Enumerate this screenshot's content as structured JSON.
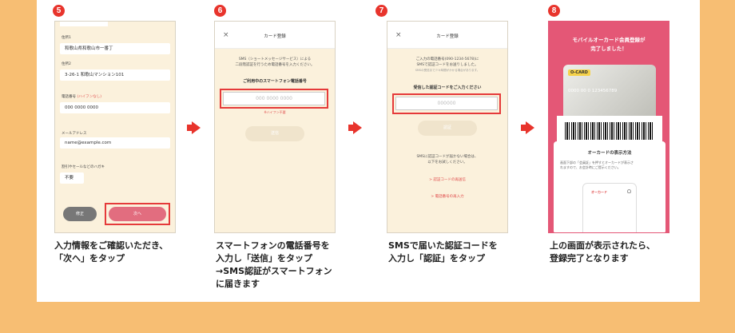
{
  "steps": [
    "5",
    "6",
    "7",
    "8"
  ],
  "phone5": {
    "addr1_label": "住所1",
    "addr1_value": "和歌山県和歌山市一番丁",
    "addr2_label": "住所2",
    "addr2_value": "3-26-1 和歌山マンション101",
    "phone_label": "電話番号",
    "phone_hint": "(ハイフンなし)",
    "phone_value": "000 0000 0000",
    "email_label": "メールアドレス",
    "email_value": "name@example.com",
    "mail_label": "割引やセールなどのハガキ",
    "mail_value": "不要",
    "back_label": "修正",
    "next_label": "次へ"
  },
  "phone6": {
    "title": "カード登録",
    "close": "×",
    "desc1": "SMS（ショートメッセージサービス）による",
    "desc2": "二段階認証を行うため電話番号を入力ください。",
    "field_label": "ご利用中のスマートフォン電話番号",
    "placeholder": "000  0000  0000",
    "hint": "※ハイフン不要",
    "send": "送信"
  },
  "phone7": {
    "title": "カード登録",
    "close": "×",
    "desc1": "ご入力の電話番号(090-1234-5678)に",
    "desc2": "SMSで認証コードをお送りしました。",
    "desc3": "SMSの受信まで少々時間がかかる場合があります。",
    "field_label": "受信した認証コードをご入力ください",
    "placeholder": "000000",
    "auth": "認証",
    "no_sms1": "SMSに認証コードが届かない場合は、",
    "no_sms2": "以下をお試しください。",
    "resend": "> 認証コードの再送信",
    "reenter": "> 電話番号の再入力"
  },
  "phone8": {
    "done1": "モバイルオーカード会員登録が",
    "done2": "完了しました！",
    "card_brand": "O-CARD",
    "card_number": "0000 00 0 123456789",
    "how_title": "オーカードの表示方法",
    "how_desc1": "画面下部の「会員証」を押すとオーカードが表示さ",
    "how_desc2": "れますので、お会計時にご提示ください。",
    "mini_logo": "オーカード"
  },
  "captions": {
    "c5": [
      "入力情報をご確認いただき、",
      "「次へ」をタップ"
    ],
    "c6": [
      "スマートフォンの電話番号を",
      "入力し「送信」をタップ",
      "→SMS認証がスマートフォン",
      "に届きます"
    ],
    "c7": [
      "SMSで届いた認証コードを",
      "入力し「認証」をタップ"
    ],
    "c8": [
      "上の画面が表示されたら、",
      "登録完了となります"
    ]
  },
  "colors": {
    "background": "#f7be73",
    "accent": "#e8342c",
    "pink": "#e45776"
  }
}
